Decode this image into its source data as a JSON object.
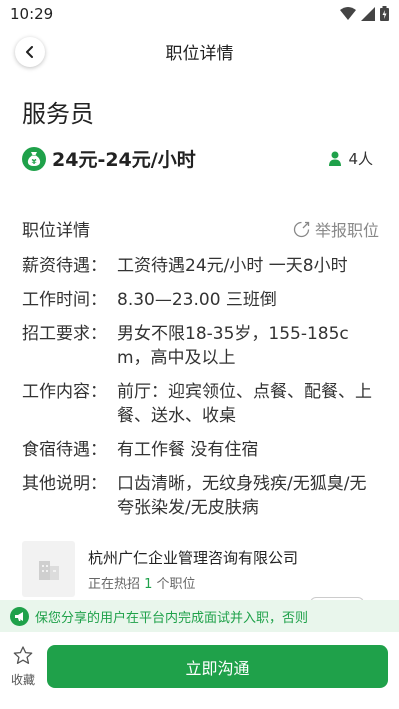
{
  "status_bar": {
    "time": "10:29"
  },
  "header": {
    "title": "职位详情"
  },
  "job": {
    "title": "服务员",
    "salary": "24元-24元/小时",
    "headcount": "4人"
  },
  "details": {
    "heading": "职位详情",
    "report_label": "举报职位",
    "rows": [
      {
        "label": "薪资待遇：",
        "value": "工资待遇24元/小时 一天8小时"
      },
      {
        "label": "工作时间：",
        "value": "8.30—23.00 三班倒"
      },
      {
        "label": "招工要求：",
        "value": "男女不限18-35岁，155-185cm，高中及以上"
      },
      {
        "label": "工作内容：",
        "value": "前厅：迎宾领位、点餐、配餐、上餐、送水、收桌"
      },
      {
        "label": "食宿待遇：",
        "value": "有工作餐 没有住宿"
      },
      {
        "label": "其他说明：",
        "value": "口齿清晰，无纹身残疾/无狐臭/无夸张染发/无皮肤病"
      }
    ]
  },
  "company": {
    "name": "杭州广仁企业管理咨询有限公司",
    "hiring_prefix": "正在热招 ",
    "hiring_count": "1",
    "hiring_suffix": " 个职位"
  },
  "notice": {
    "text": "保您分享的用户在平台内完成面试并入职，否则"
  },
  "bottom": {
    "favorite_label": "收藏",
    "chat_label": "立即沟通"
  },
  "colors": {
    "accent": "#1fa14a",
    "notice_bg": "#e9f6ec"
  }
}
